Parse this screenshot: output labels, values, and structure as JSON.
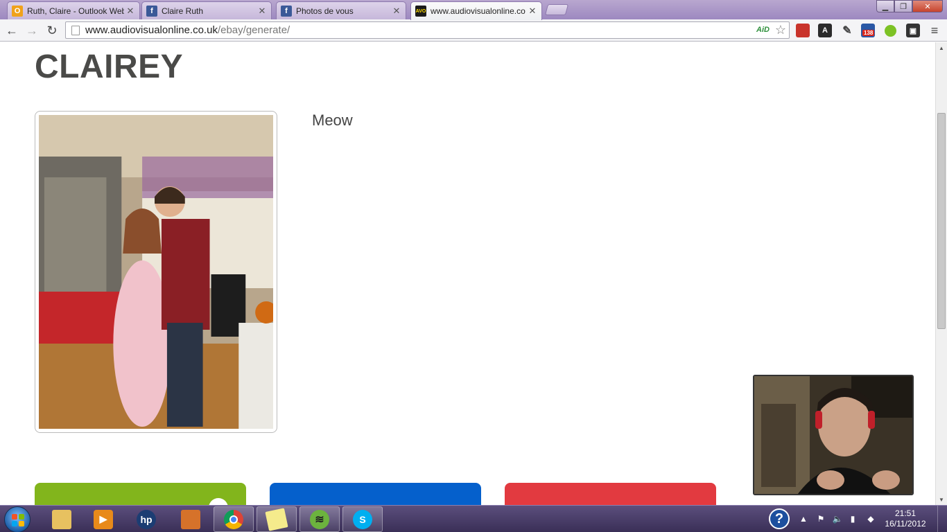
{
  "browser": {
    "tabs": [
      {
        "title": "Ruth, Claire - Outlook Web",
        "favicon": "outlook-icon"
      },
      {
        "title": "Claire Ruth",
        "favicon": "facebook-icon"
      },
      {
        "title": "Photos de vous",
        "favicon": "facebook-icon"
      },
      {
        "title": "www.audiovisualonline.co",
        "favicon": "avo-icon",
        "active": true
      }
    ],
    "url_host": "www.audiovisualonline.co.uk",
    "url_path": "/ebay/generate/",
    "addon_label": "AiD",
    "notification_count": "138"
  },
  "page": {
    "title": "CLAIREY",
    "description": "Meow"
  },
  "taskbar": {
    "apps": [
      "explorer",
      "media-center",
      "hp",
      "paint",
      "chrome",
      "sticky-notes",
      "spotify",
      "skype"
    ],
    "clock_time": "21:51",
    "clock_date": "16/11/2012"
  },
  "colors": {
    "card_green": "#82b51c",
    "card_blue": "#0560cc",
    "card_red": "#e23a40",
    "heading": "#4a4a48"
  }
}
